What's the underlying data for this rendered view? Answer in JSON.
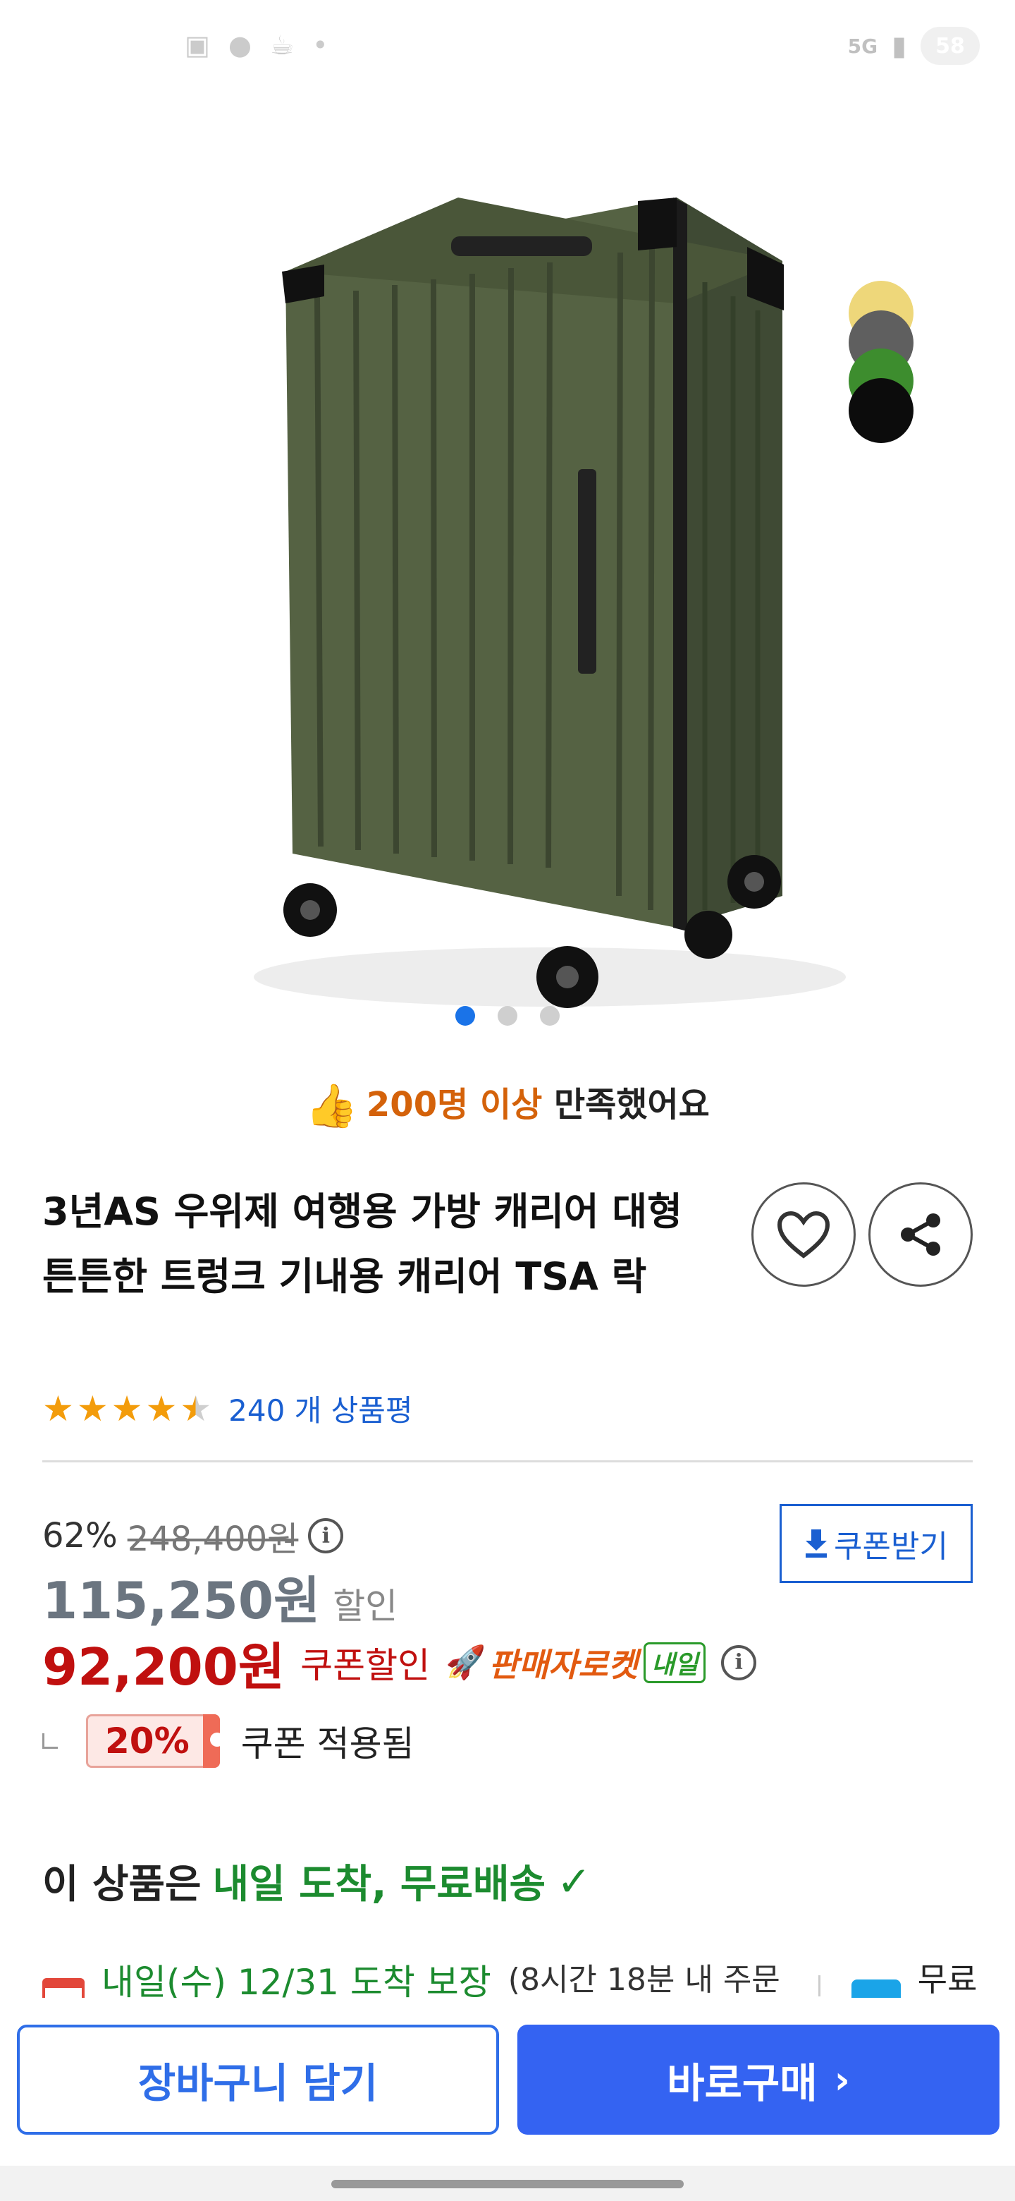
{
  "status_bar": {
    "network": "5G",
    "battery": "58"
  },
  "cropped_header": "",
  "gallery": {
    "image_alt": "",
    "swatch_colors": [
      "#eed77a",
      "#5f5f5f",
      "#3d8d2e",
      "#0c0c0c"
    ],
    "dot_count": 3,
    "active_dot": 0
  },
  "satisfaction": {
    "highlight": "200명 이상",
    "rest": "만족했어요"
  },
  "product": {
    "title": "3년AS 우위제 여행용 가방 캐리어 대형 튼튼한 트렁크 기내용 캐리어 TSA 락",
    "rating": 4.5,
    "review_text": "240 개 상품평"
  },
  "pricing": {
    "discount_rate": "62%",
    "original_price": "248,400원",
    "sale_price": "115,250원",
    "sale_label": "할인",
    "coupon_price": "92,200원",
    "coupon_label": "쿠폰할인",
    "seller_rocket": "판매자로켓",
    "tomorrow_badge": "내일",
    "coupon_button": "쿠폰받기",
    "coupon_percent": "20%",
    "coupon_applied": "쿠폰 적용됨"
  },
  "delivery": {
    "prefix": "이 상품은",
    "highlight": "내일 도착, 무료배송",
    "guarantee": "내일(수) 12/31 도착 보장",
    "cutoff": "(8시간 18분 내 주문",
    "free_label": "무료"
  },
  "actions": {
    "cart": "장바구니 담기",
    "buy": "바로구매"
  }
}
